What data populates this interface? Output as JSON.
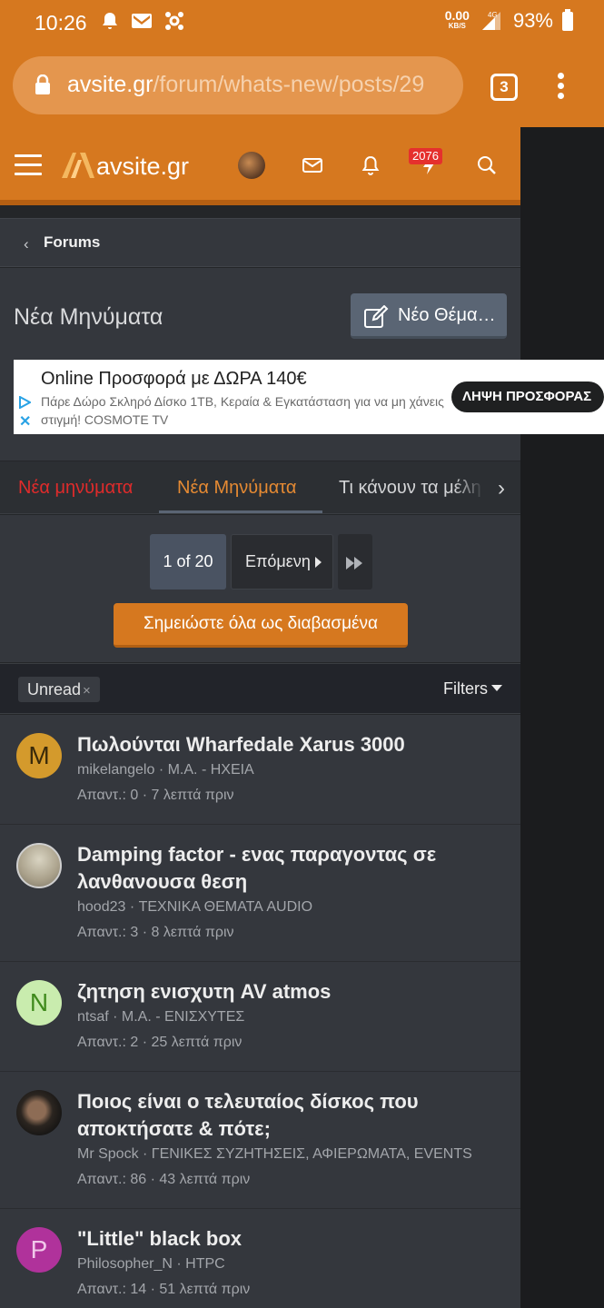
{
  "status_bar": {
    "time": "10:26",
    "speed_value": "0.00",
    "speed_unit": "KB/S",
    "network": "4G",
    "battery": "93%"
  },
  "browser": {
    "url_host": "avsite.gr",
    "url_path": "/forum/whats-new/posts/29",
    "tab_count": "3"
  },
  "site_header": {
    "logo_text": "avsite.gr",
    "notification_badge": "2076"
  },
  "breadcrumb": {
    "label": "Forums"
  },
  "page": {
    "title": "Νέα Μηνύματα",
    "new_thread_label": "Νέο Θέμα…"
  },
  "ad": {
    "title": "Online Προσφορά με ΔΩΡΑ 140€",
    "description": "Πάρε Δώρο Σκληρό Δίσκο 1TB, Κεραία & Εγκατάσταση για να μη χάνεις στιγμή! COSMOTE TV",
    "cta": "ΛΗΨΗ ΠΡΟΣΦΟΡΑΣ"
  },
  "tabs": [
    {
      "label": "Νέα μηνύματα"
    },
    {
      "label": "Νέα Μηνύματα"
    },
    {
      "label": "Τι κάνουν τα μέλη"
    }
  ],
  "pagination": {
    "current": "1 of 20",
    "next_label": "Επόμενη"
  },
  "mark_read_label": "Σημειώστε όλα ως διαβασμένα",
  "filters": {
    "chip": "Unread",
    "chip_remove": "×",
    "label": "Filters"
  },
  "threads": [
    {
      "avatar_letter": "M",
      "avatar_color": "#d49a2c",
      "title": "Πωλούνται Wharfedale Xarus 3000",
      "meta": "mikelangelo · Μ.Α. - ΗΧΕΙΑ",
      "stats": "Απαντ.: 0 · 7 λεπτά πριν"
    },
    {
      "avatar_letter": "",
      "avatar_color": "#b9b5a8",
      "title": "Damping factor - ενας παραγοντας σε λανθανουσα θεση",
      "meta": "hood23 · ΤΕΧΝΙΚΑ ΘΕΜΑΤΑ AUDIO",
      "stats": "Απαντ.: 3 · 8 λεπτά πριν"
    },
    {
      "avatar_letter": "N",
      "avatar_color": "#c9ecae",
      "title": "ζητηση ενισχυτη AV atmos",
      "meta": "ntsaf · Μ.Α. - ΕΝΙΣΧΥΤΕΣ",
      "stats": "Απαντ.: 2 · 25 λεπτά πριν"
    },
    {
      "avatar_letter": "",
      "avatar_color": "#2b2520",
      "title": "Ποιος είναι ο τελευταίος δίσκος που αποκτήσατε & πότε;",
      "meta": "Mr Spock · ΓΕΝΙΚΕΣ ΣΥΖΗΤΗΣΕΙΣ, ΑΦΙΕΡΩΜΑΤΑ, EVENTS",
      "stats": "Απαντ.: 86 · 43 λεπτά πριν"
    },
    {
      "avatar_letter": "P",
      "avatar_color": "#b0329b",
      "title": "\"Little\" black box",
      "meta": "Philosopher_N · HTPC",
      "stats": "Απαντ.: 14 · 51 λεπτά πριν"
    }
  ]
}
